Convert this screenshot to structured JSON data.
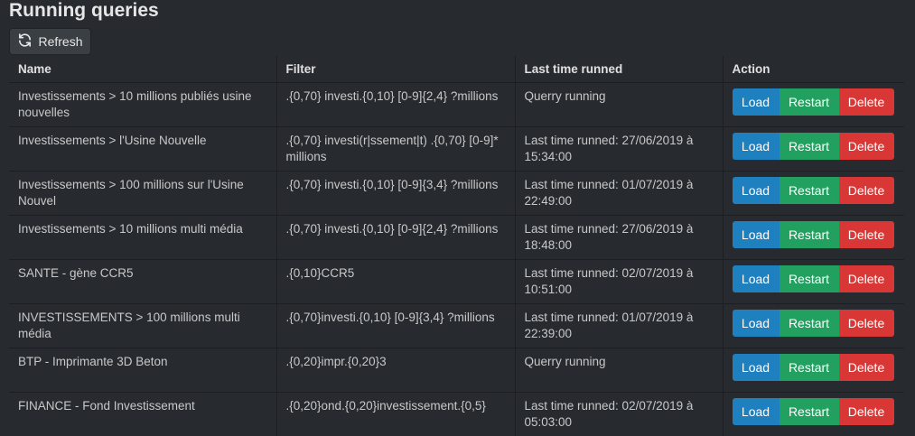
{
  "page": {
    "title": "Running queries"
  },
  "toolbar": {
    "refresh_label": "Refresh",
    "refresh_icon": "refresh-icon"
  },
  "table": {
    "headers": {
      "name": "Name",
      "filter": "Filter",
      "last_run": "Last time runned",
      "action": "Action"
    },
    "action_labels": {
      "load": "Load",
      "restart": "Restart",
      "delete": "Delete"
    },
    "rows": [
      {
        "name": "Investissements > 10 millions publiés usine nouvelles",
        "filter": ".{0,70} investi.{0,10} [0-9]{2,4} ?millions",
        "last_run": "Querry running"
      },
      {
        "name": "Investissements > l'Usine Nouvelle",
        "filter": ".{0,70} investi(r|ssement|t) .{0,70} [0-9]* millions",
        "last_run": "Last time runned: 27/06/2019 à 15:34:00"
      },
      {
        "name": "Investissements > 100 millions sur l'Usine Nouvel",
        "filter": ".{0,70} investi.{0,10} [0-9]{3,4} ?millions",
        "last_run": "Last time runned: 01/07/2019 à 22:49:00"
      },
      {
        "name": "Investissements > 10 millions multi média",
        "filter": ".{0,70} investi.{0,10} [0-9]{2,4} ?millions",
        "last_run": "Last time runned: 27/06/2019 à 18:48:00"
      },
      {
        "name": "SANTE - gène CCR5",
        "filter": ".{0,10}CCR5",
        "last_run": "Last time runned: 02/07/2019 à 10:51:00"
      },
      {
        "name": "INVESTISSEMENTS > 100 millions multi média",
        "filter": ".{0,70}investi.{0,10} [0-9]{3,4} ?millions",
        "last_run": "Last time runned: 01/07/2019 à 22:39:00"
      },
      {
        "name": "BTP - Imprimante 3D Beton",
        "filter": ".{0,20}impr.{0,20}3",
        "last_run": "Querry running"
      },
      {
        "name": "FINANCE - Fond Investissement",
        "filter": ".{0,20}ond.{0,20}investissement.{0,5}",
        "last_run": "Last time runned: 02/07/2019 à 05:03:00"
      }
    ]
  },
  "colors": {
    "background": "#272b30",
    "load": "#1f80c0",
    "restart": "#22a060",
    "delete": "#d93636"
  }
}
